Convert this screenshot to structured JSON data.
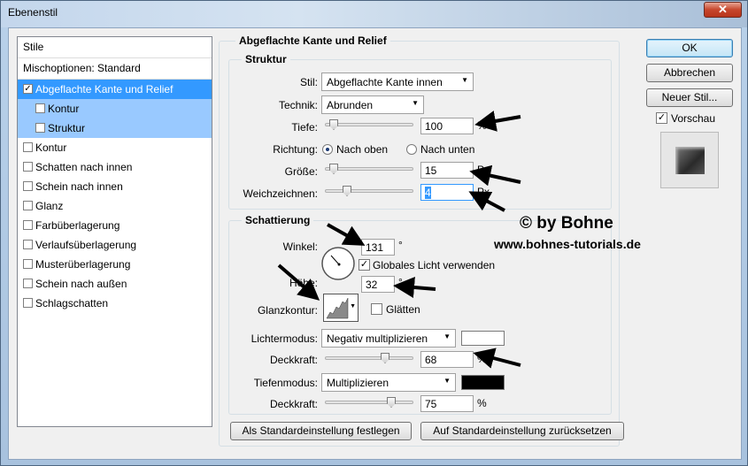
{
  "window": {
    "title": "Ebenenstil",
    "close": "✕"
  },
  "stylelist": {
    "header": "Stile",
    "mix": "Mischoptionen: Standard",
    "items": [
      {
        "label": "Abgeflachte Kante und Relief",
        "checked": true
      },
      {
        "label": "Kontur",
        "checked": false
      },
      {
        "label": "Struktur",
        "checked": false
      },
      {
        "label": "Kontur",
        "checked": false
      },
      {
        "label": "Schatten nach innen",
        "checked": false
      },
      {
        "label": "Schein nach innen",
        "checked": false
      },
      {
        "label": "Glanz",
        "checked": false
      },
      {
        "label": "Farbüberlagerung",
        "checked": false
      },
      {
        "label": "Verlaufsüberlagerung",
        "checked": false
      },
      {
        "label": "Musterüberlagerung",
        "checked": false
      },
      {
        "label": "Schein nach außen",
        "checked": false
      },
      {
        "label": "Schlagschatten",
        "checked": false
      }
    ]
  },
  "panel": {
    "title": "Abgeflachte Kante und Relief",
    "structure": {
      "title": "Struktur",
      "style_label": "Stil:",
      "style_value": "Abgeflachte Kante innen",
      "technique_label": "Technik:",
      "technique_value": "Abrunden",
      "depth_label": "Tiefe:",
      "depth_value": "100",
      "depth_unit": "%",
      "direction_label": "Richtung:",
      "direction_up": "Nach oben",
      "direction_down": "Nach unten",
      "size_label": "Größe:",
      "size_value": "15",
      "size_unit": "Px",
      "soften_label": "Weichzeichnen:",
      "soften_value": "4",
      "soften_unit": "Px"
    },
    "shading": {
      "title": "Schattierung",
      "angle_label": "Winkel:",
      "angle_value": "131",
      "angle_unit": "°",
      "global_light_label": "Globales Licht verwenden",
      "altitude_label": "Höhe:",
      "altitude_value": "32",
      "altitude_unit": "°",
      "gloss_label": "Glanzkontur:",
      "antialias_label": "Glätten",
      "highlight_label": "Lichtermodus:",
      "highlight_value": "Negativ multiplizieren",
      "highlight_opacity_label": "Deckkraft:",
      "highlight_opacity_value": "68",
      "highlight_opacity_unit": "%",
      "shadow_label": "Tiefenmodus:",
      "shadow_value": "Multiplizieren",
      "shadow_opacity_label": "Deckkraft:",
      "shadow_opacity_value": "75",
      "shadow_opacity_unit": "%"
    },
    "make_default": "Als Standardeinstellung festlegen",
    "reset_default": "Auf Standardeinstellung zurücksetzen"
  },
  "buttons": {
    "ok": "OK",
    "cancel": "Abbrechen",
    "new_style": "Neuer Stil...",
    "preview": "Vorschau"
  },
  "sliders": {
    "depth": 0.1,
    "size": 0.1,
    "soften": 0.25,
    "highlight_opacity": 0.68,
    "shadow_opacity": 0.75
  },
  "watermark": {
    "line1": "© by Bohne",
    "line2": "www.bohnes-tutorials.de"
  },
  "colors": {
    "selection": "#3399ff",
    "highlight_color": "#ffffff",
    "shadow_color": "#000000"
  }
}
